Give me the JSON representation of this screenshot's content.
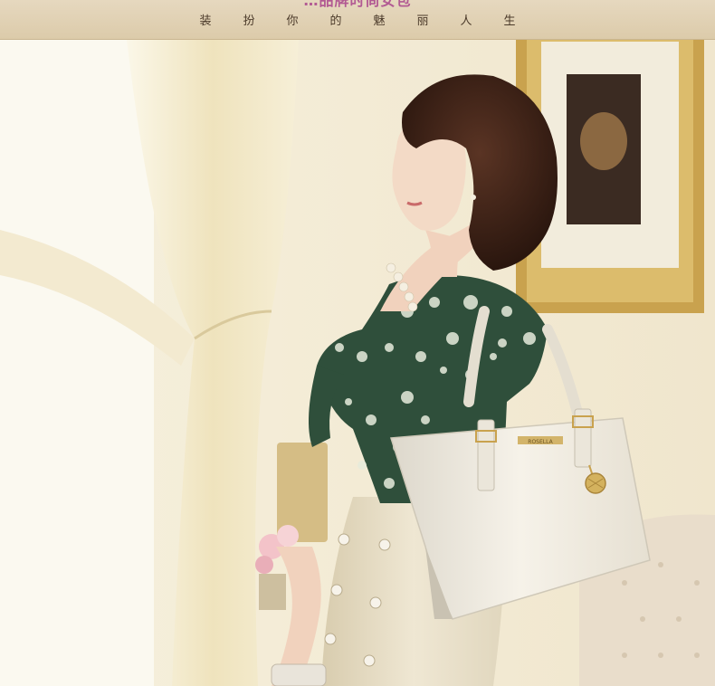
{
  "banner": {
    "top_text": "…品牌时尚女包",
    "slogan": [
      "装",
      "扮",
      "你",
      "的",
      "魅",
      "丽",
      "人",
      "生"
    ]
  },
  "bag": {
    "logo_text": "ROSELLA",
    "color": "#f1ede3"
  },
  "colors": {
    "banner_bg": "#dccbaa",
    "frame_gold": "#c9a24e",
    "curtain": "#f0e7c9",
    "skirt": "#ece4cf",
    "blouse_green": "#2f4f3b"
  },
  "icons": [
    "pendant-icon",
    "button-icon"
  ]
}
